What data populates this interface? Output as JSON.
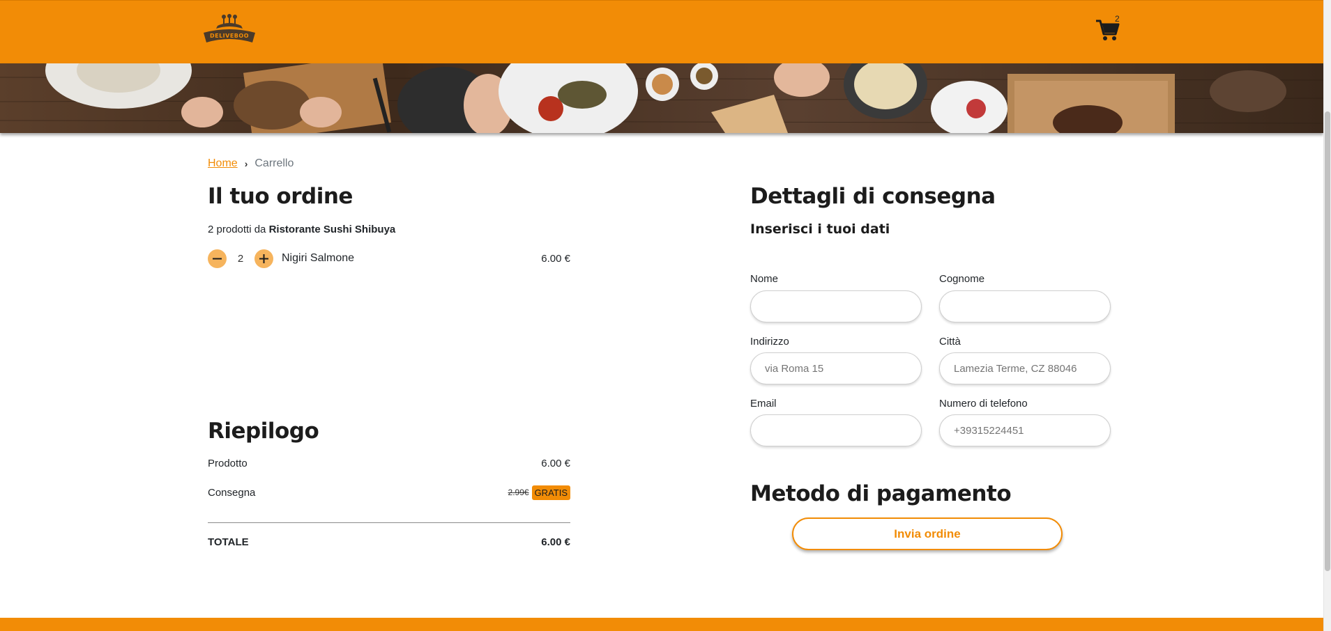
{
  "header": {
    "logo_text": "DELIVEBOO",
    "cart_count": "2"
  },
  "breadcrumb": {
    "home": "Home",
    "current": "Carrello"
  },
  "order": {
    "title": "Il tuo ordine",
    "count_text": "2 prodotti da ",
    "restaurant": "Ristorante Sushi Shibuya",
    "items": [
      {
        "quantity": "2",
        "name": "Nigiri Salmone",
        "price": "6.00 €"
      }
    ]
  },
  "summary": {
    "title": "Riepilogo",
    "product_label": "Prodotto",
    "product_value": "6.00 €",
    "delivery_label": "Consegna",
    "delivery_old": "2.99€",
    "delivery_badge": "GRATIS",
    "total_label": "TOTALE",
    "total_value": "6.00 €"
  },
  "delivery": {
    "title": "Dettagli di consegna",
    "subtitle": "Inserisci i tuoi dati",
    "fields": {
      "nome": {
        "label": "Nome",
        "placeholder": ""
      },
      "cognome": {
        "label": "Cognome",
        "placeholder": ""
      },
      "indirizzo": {
        "label": "Indirizzo",
        "placeholder": "via Roma 15"
      },
      "citta": {
        "label": "Città",
        "placeholder": "Lamezia Terme, CZ 88046"
      },
      "email": {
        "label": "Email",
        "placeholder": ""
      },
      "telefono": {
        "label": "Numero di telefono",
        "placeholder": "+39315224451"
      }
    }
  },
  "payment": {
    "title": "Metodo di pagamento",
    "submit_label": "Invia ordine"
  },
  "colors": {
    "brand": "#f28c06",
    "qty_button": "#f6b45d"
  }
}
